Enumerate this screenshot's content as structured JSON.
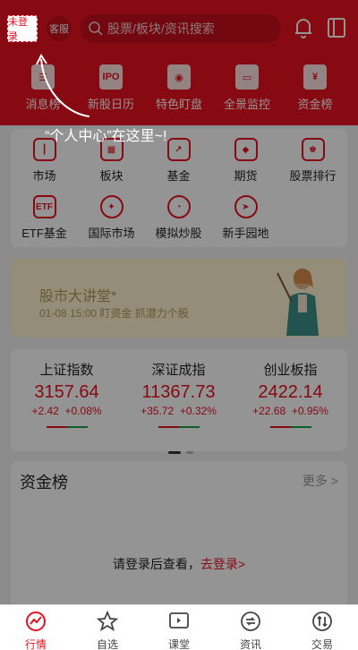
{
  "header": {
    "login_badge": "未登录",
    "service_badge": "客服",
    "search_placeholder": "股票/板块/资讯搜索"
  },
  "top_menu": [
    {
      "label": "消息榜",
      "icon": "message-board-icon"
    },
    {
      "label": "新股日历",
      "icon": "ipo-calendar-icon",
      "icon_text": "IPO"
    },
    {
      "label": "特色盯盘",
      "icon": "watch-icon"
    },
    {
      "label": "全景监控",
      "icon": "monitor-icon"
    },
    {
      "label": "资金榜",
      "icon": "fund-board-icon",
      "icon_text": "¥"
    }
  ],
  "grid": [
    {
      "label": "市场",
      "icon": "market-icon"
    },
    {
      "label": "板块",
      "icon": "sector-icon"
    },
    {
      "label": "基金",
      "icon": "fund-icon"
    },
    {
      "label": "期货",
      "icon": "futures-icon"
    },
    {
      "label": "股票排行",
      "icon": "ranking-icon"
    },
    {
      "label": "ETF基金",
      "icon": "etf-icon",
      "icon_text": "ETF"
    },
    {
      "label": "国际市场",
      "icon": "global-market-icon"
    },
    {
      "label": "模拟炒股",
      "icon": "simulated-trading-icon"
    },
    {
      "label": "新手园地",
      "icon": "newbie-icon"
    }
  ],
  "banner": {
    "title": "股市大讲堂*",
    "subtitle": "01-08 15:00 盯资金 抓潜力个股"
  },
  "indices": [
    {
      "name": "上证指数",
      "value": "3157.64",
      "change": "+2.42",
      "percent": "+0.08%"
    },
    {
      "name": "深证成指",
      "value": "11367.73",
      "change": "+35.72",
      "percent": "+0.32%"
    },
    {
      "name": "创业板指",
      "value": "2422.14",
      "change": "+22.68",
      "percent": "+0.95%"
    }
  ],
  "fund_board": {
    "title": "资金榜",
    "more": "更多 >",
    "tip": "请登录后查看，",
    "tip_link": "去登录>"
  },
  "overlay": {
    "hint": "“个人中心”在这里~!"
  },
  "tabs": [
    {
      "label": "行情",
      "icon": "market-trend-icon",
      "active": true
    },
    {
      "label": "自选",
      "icon": "star-icon",
      "active": false
    },
    {
      "label": "课堂",
      "icon": "classroom-icon",
      "active": false
    },
    {
      "label": "资讯",
      "icon": "news-icon",
      "active": false
    },
    {
      "label": "交易",
      "icon": "trade-icon",
      "active": false
    }
  ],
  "colors": {
    "brand": "#e8101f",
    "rise": "#e8101f",
    "fall": "#19a34a"
  }
}
